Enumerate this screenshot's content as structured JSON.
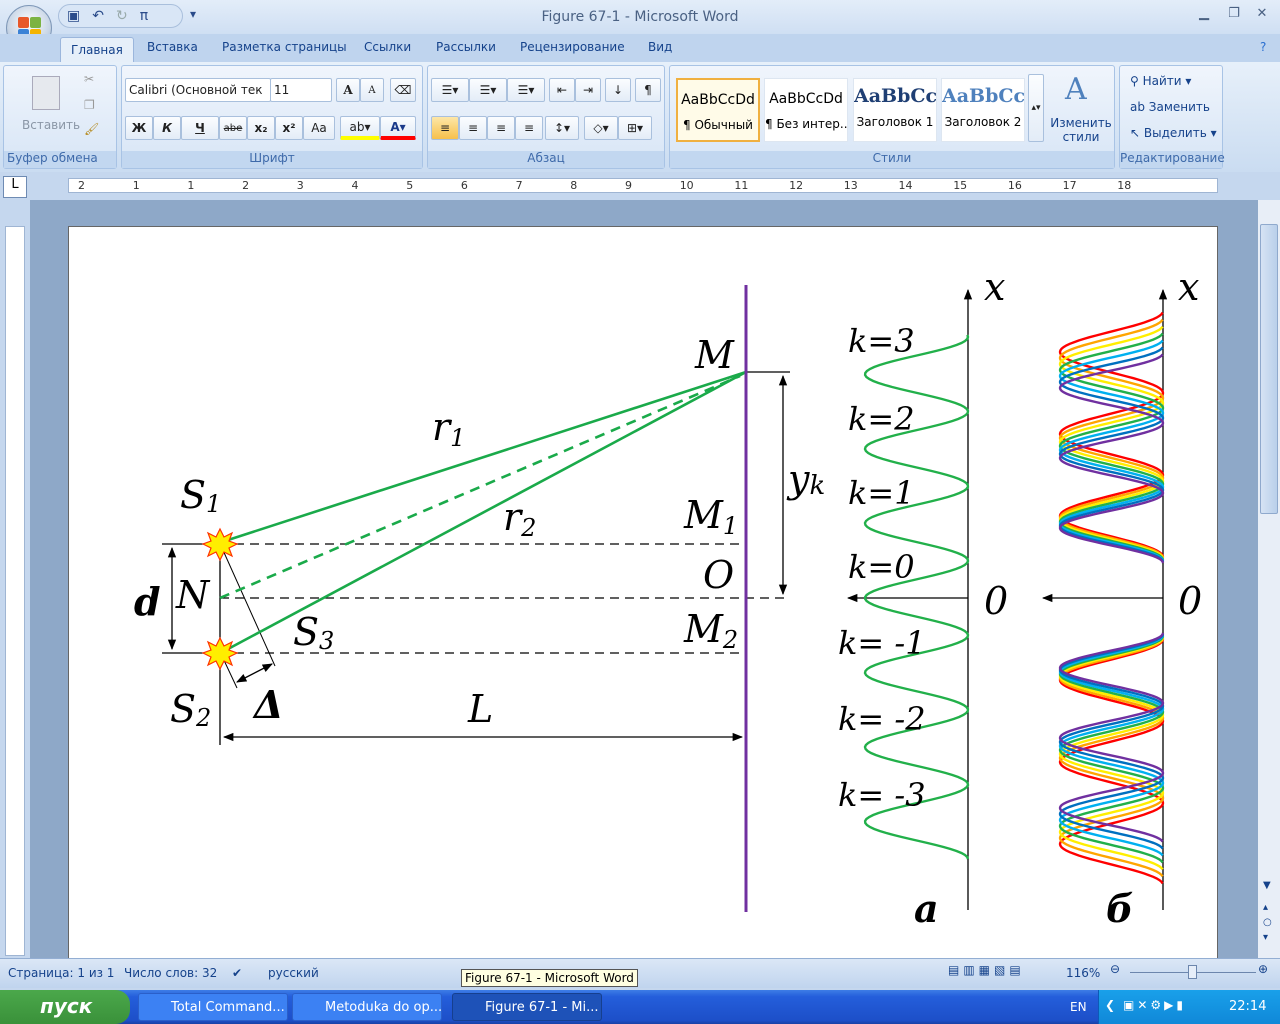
{
  "window": {
    "title": "Figure 67-1 - Microsoft Word"
  },
  "qat": {
    "save": "save-icon",
    "undo": "undo-icon",
    "redo": "redo-icon",
    "pi": "π",
    "more": "▾"
  },
  "tabs": [
    "Главная",
    "Вставка",
    "Разметка страницы",
    "Ссылки",
    "Рассылки",
    "Рецензирование",
    "Вид"
  ],
  "ribbon": {
    "clipboard": {
      "label": "Буфер обмена",
      "paste": "Вставить"
    },
    "font": {
      "label": "Шрифт",
      "name": "Calibri (Основной тек",
      "size": "11",
      "bold": "Ж",
      "italic": "К",
      "underline": "Ч",
      "strike": "abe",
      "sub": "x₂",
      "sup": "x²",
      "case": "Aa",
      "grow": "A",
      "shrink": "A",
      "highlight_color": "#ffff00",
      "font_color": "#ff0000"
    },
    "paragraph": {
      "label": "Абзац"
    },
    "styles": {
      "label": "Стили",
      "items": [
        {
          "sample": "AaBbCcDd",
          "name": "¶ Обычный"
        },
        {
          "sample": "AaBbCcDd",
          "name": "¶ Без интер..."
        },
        {
          "sample": "AaBbCc",
          "name": "Заголовок 1"
        },
        {
          "sample": "AaBbCc",
          "name": "Заголовок 2"
        }
      ],
      "change": "Изменить стили"
    },
    "editing": {
      "label": "Редактирование",
      "find": "Найти",
      "replace": "Заменить",
      "select": "Выделить"
    }
  },
  "ruler": {
    "ticks": [
      "2",
      "1",
      "1",
      "2",
      "3",
      "4",
      "5",
      "6",
      "7",
      "8",
      "9",
      "10",
      "11",
      "12",
      "13",
      "14",
      "15",
      "16",
      "17",
      "18"
    ]
  },
  "diagram": {
    "labels": {
      "M": "M",
      "M1": "M",
      "M1sub": "1",
      "M2": "M",
      "M2sub": "2",
      "O": "O",
      "r1": "r",
      "r1sub": "1",
      "r2": "r",
      "r2sub": "2",
      "S1": "S",
      "S1sub": "1",
      "S2": "S",
      "S2sub": "2",
      "S3": "S",
      "S3sub": "3",
      "N": "N",
      "d": "d",
      "delta": "Δ",
      "L": "L",
      "yk": "y",
      "yksub": "k",
      "xa": "x",
      "xb": "x",
      "zeroa": "0",
      "zerob": "0",
      "a": "a",
      "b": "б"
    },
    "orders": [
      "k=3",
      "k=2",
      "k=1",
      "k=0",
      "k= -1",
      "k= -2",
      "k= -3"
    ],
    "colors": {
      "rays": "#1aaa4a",
      "screen": "#7030a0",
      "pattern": "#22b04a",
      "spectrum": [
        "#ff0000",
        "#ffa500",
        "#ffee00",
        "#22b04a",
        "#00b0f0",
        "#0070c0",
        "#7030a0"
      ]
    }
  },
  "status": {
    "page": "Страница: 1 из 1",
    "words": "Число слов: 32",
    "lang": "русский",
    "zoom": "116%"
  },
  "tooltip": "Figure 67-1 - Microsoft Word",
  "taskbar": {
    "start": "пуск",
    "tasks": [
      "Total Command...",
      "Metoduka do op...",
      "Figure 67-1 - Mi..."
    ],
    "lang": "EN",
    "clock": "22:14"
  }
}
